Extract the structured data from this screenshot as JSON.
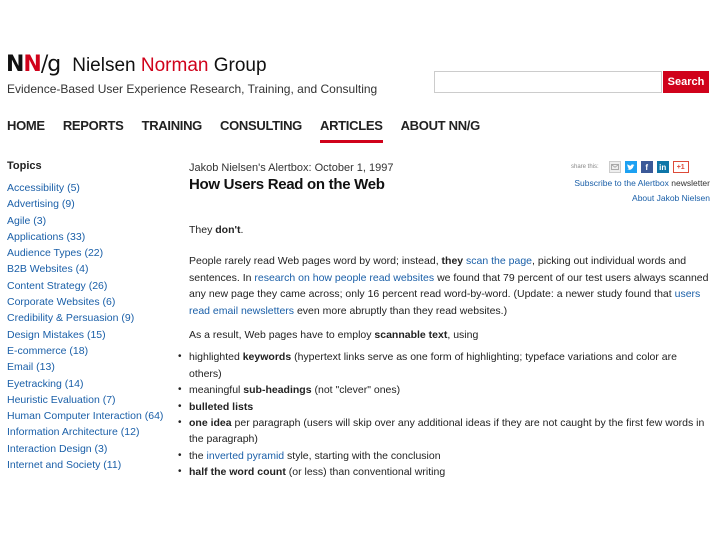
{
  "header": {
    "logo_n1": "N",
    "logo_n2": "N",
    "logo_slash": "/",
    "logo_g": "g",
    "brand_part1": "Nielsen ",
    "brand_part2": "Norman",
    "brand_part3": " Group",
    "tagline": "Evidence-Based User Experience Research, Training, and Consulting",
    "search_placeholder": "",
    "search_button": "Search"
  },
  "nav": {
    "items": [
      {
        "label": "HOME"
      },
      {
        "label": "REPORTS"
      },
      {
        "label": "TRAINING"
      },
      {
        "label": "CONSULTING"
      },
      {
        "label": "ARTICLES"
      },
      {
        "label": "ABOUT NN/G"
      }
    ],
    "active_index": 4
  },
  "sidebar": {
    "heading": "Topics",
    "topics": [
      "Accessibility (5)",
      "Advertising (9)",
      "Agile (3)",
      "Applications (33)",
      "Audience Types (22)",
      "B2B Websites (4)",
      "Content Strategy (26)",
      "Corporate Websites (6)",
      "Credibility & Persuasion (9)",
      "Design Mistakes (15)",
      "E-commerce (18)",
      "Email (13)",
      "Eyetracking (14)",
      "Heuristic Evaluation (7)",
      "Human Computer Interaction (64)",
      "Information Architecture (12)",
      "Interaction Design (3)",
      "Internet and Society (11)"
    ]
  },
  "article": {
    "byline": "Jakob Nielsen's Alertbox: October 1, 1997",
    "title": "How Users Read on the Web",
    "share_label": "share this:",
    "share_gplus": "+1",
    "subscribe_link": "Subscribe to the Alertbox",
    "subscribe_suffix": " newsletter",
    "about_link": "About Jakob Nielsen",
    "p1_a": "They ",
    "p1_b": "don't",
    "p1_c": ".",
    "p2_a": "People rarely read Web pages word by word; instead, ",
    "p2_b": "they ",
    "p2_link1": "scan the page",
    "p2_c": ", picking out individual words and sentences. In ",
    "p2_link2": "research on how people read websites",
    "p2_d": " we found that 79 percent of our test users always scanned any new page they came across; only 16 percent read word-by-word. (Update: a newer study found that ",
    "p2_link3": "users read email newsletters",
    "p2_e": " even more abruptly than they read websites.)",
    "p3_a": "As a result, Web pages have to employ ",
    "p3_b": "scannable text",
    "p3_c": ", using",
    "b1_a": "highlighted ",
    "b1_b": "keywords",
    "b1_c": " (hypertext links serve as one form of highlighting; typeface variations and color are others)",
    "b2_a": "meaningful ",
    "b2_b": "sub-headings",
    "b2_c": " (not \"clever\" ones)",
    "b3": "bulleted lists",
    "b4_a": "one idea",
    "b4_b": " per paragraph (users will skip over any additional ideas if they are not caught by the first few words in the paragraph)",
    "b5_a": "the ",
    "b5_link": "inverted pyramid",
    "b5_b": " style, starting with the conclusion",
    "b6_a": "half the word count",
    "b6_b": " (or less) than conventional writing"
  },
  "colors": {
    "brand_red": "#d0021b",
    "link_blue": "#1a5fa8"
  },
  "icons": [
    "email-icon",
    "twitter-icon",
    "facebook-icon",
    "linkedin-icon",
    "google-plus-icon"
  ]
}
